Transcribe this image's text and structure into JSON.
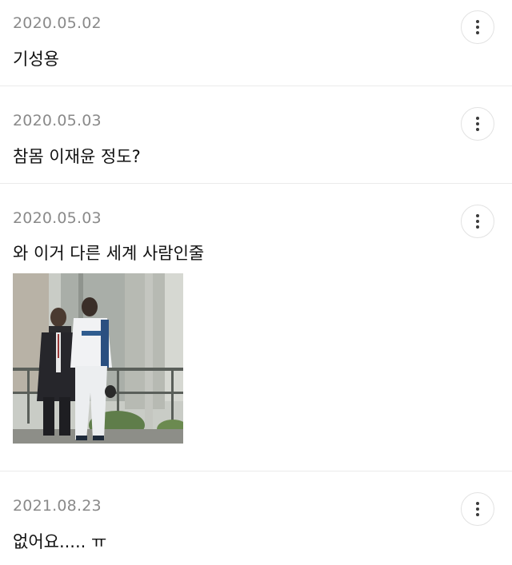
{
  "comments": [
    {
      "date": "2020.05.02",
      "text": "기성용"
    },
    {
      "date": "2020.05.03",
      "text": "참몸 이재윤 정도?"
    },
    {
      "date": "2020.05.03",
      "text": "와 이거 다른 세계 사람인줄"
    },
    {
      "date": "2021.08.23",
      "text": "없어요..... ㅠ"
    }
  ],
  "icons": {
    "more": "more-vertical-icon"
  }
}
